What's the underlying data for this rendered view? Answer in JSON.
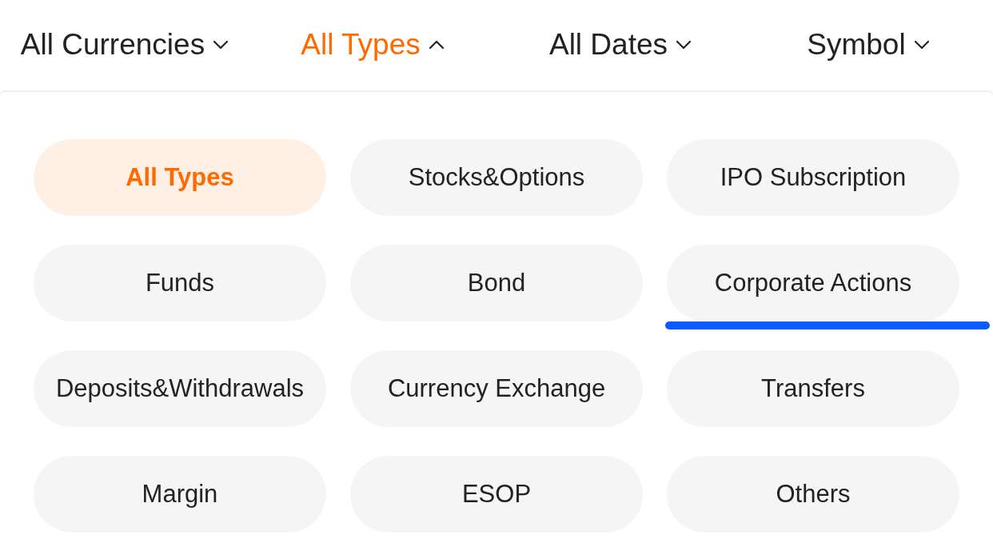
{
  "filters": [
    {
      "label": "All Currencies",
      "expanded": false
    },
    {
      "label": "All Types",
      "expanded": true
    },
    {
      "label": "All Dates",
      "expanded": false
    },
    {
      "label": "Symbol",
      "expanded": false
    }
  ],
  "options": [
    {
      "label": "All Types",
      "selected": true,
      "underlined": false
    },
    {
      "label": "Stocks&Options",
      "selected": false,
      "underlined": false
    },
    {
      "label": "IPO Subscription",
      "selected": false,
      "underlined": false
    },
    {
      "label": "Funds",
      "selected": false,
      "underlined": false
    },
    {
      "label": "Bond",
      "selected": false,
      "underlined": false
    },
    {
      "label": "Corporate Actions",
      "selected": false,
      "underlined": true
    },
    {
      "label": "Deposits&Withdrawals",
      "selected": false,
      "underlined": false
    },
    {
      "label": "Currency Exchange",
      "selected": false,
      "underlined": false
    },
    {
      "label": "Transfers",
      "selected": false,
      "underlined": false
    },
    {
      "label": "Margin",
      "selected": false,
      "underlined": false
    },
    {
      "label": "ESOP",
      "selected": false,
      "underlined": false
    },
    {
      "label": "Others",
      "selected": false,
      "underlined": false
    }
  ]
}
